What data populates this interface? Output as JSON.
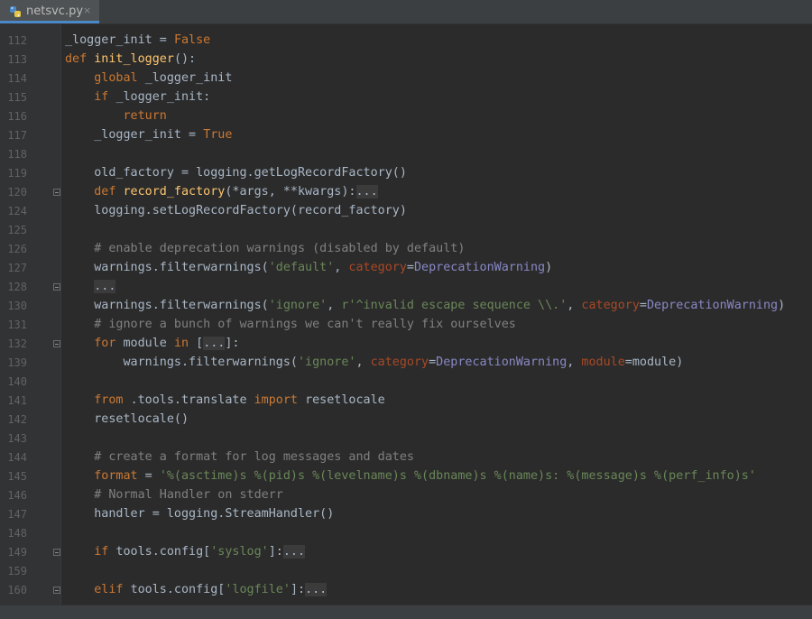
{
  "tab": {
    "filename": "netsvc.py",
    "close": "×"
  },
  "editor": {
    "lines": [
      {
        "number": "112",
        "fold": false,
        "tokens": [
          [
            "",
            "_logger_init = "
          ],
          [
            "kw",
            "False"
          ]
        ]
      },
      {
        "number": "113",
        "fold": false,
        "tokens": [
          [
            "kw",
            "def "
          ],
          [
            "fn",
            "init_logger"
          ],
          [
            "",
            "():"
          ]
        ]
      },
      {
        "number": "114",
        "fold": false,
        "tokens": [
          [
            "",
            "    "
          ],
          [
            "kw",
            "global "
          ],
          [
            "",
            "_logger_init"
          ]
        ]
      },
      {
        "number": "115",
        "fold": false,
        "tokens": [
          [
            "",
            "    "
          ],
          [
            "kw",
            "if "
          ],
          [
            "",
            "_logger_init:"
          ]
        ]
      },
      {
        "number": "116",
        "fold": false,
        "tokens": [
          [
            "",
            "        "
          ],
          [
            "kw",
            "return"
          ]
        ]
      },
      {
        "number": "117",
        "fold": false,
        "tokens": [
          [
            "",
            "    _logger_init = "
          ],
          [
            "kw",
            "True"
          ]
        ]
      },
      {
        "number": "118",
        "fold": false,
        "tokens": []
      },
      {
        "number": "119",
        "fold": false,
        "tokens": [
          [
            "",
            "    old_factory = logging.getLogRecordFactory()"
          ]
        ]
      },
      {
        "number": "120",
        "fold": true,
        "tokens": [
          [
            "",
            "    "
          ],
          [
            "kw",
            "def "
          ],
          [
            "fn",
            "record_factory"
          ],
          [
            "",
            "(*args, **kwargs):"
          ],
          [
            "ph",
            "..."
          ]
        ]
      },
      {
        "number": "124",
        "fold": false,
        "tokens": [
          [
            "",
            "    logging.setLogRecordFactory(record_factory)"
          ]
        ]
      },
      {
        "number": "125",
        "fold": false,
        "tokens": []
      },
      {
        "number": "126",
        "fold": false,
        "tokens": [
          [
            "",
            "    "
          ],
          [
            "cm",
            "# enable deprecation warnings (disabled by default)"
          ]
        ]
      },
      {
        "number": "127",
        "fold": false,
        "tokens": [
          [
            "",
            "    warnings.filterwarnings("
          ],
          [
            "st",
            "'default'"
          ],
          [
            "",
            ", "
          ],
          [
            "kp",
            "category"
          ],
          [
            "",
            "="
          ],
          [
            "cl",
            "DeprecationWarning"
          ],
          [
            "",
            ")"
          ]
        ]
      },
      {
        "number": "128",
        "fold": true,
        "tokens": [
          [
            "",
            "    "
          ],
          [
            "ph",
            "..."
          ]
        ]
      },
      {
        "number": "130",
        "fold": false,
        "tokens": [
          [
            "",
            "    warnings.filterwarnings("
          ],
          [
            "st",
            "'ignore'"
          ],
          [
            "",
            ", "
          ],
          [
            "st",
            "r'^invalid escape sequence \\\\.'"
          ],
          [
            "",
            ", "
          ],
          [
            "kp",
            "category"
          ],
          [
            "",
            "="
          ],
          [
            "cl",
            "DeprecationWarning"
          ],
          [
            "",
            ")"
          ]
        ]
      },
      {
        "number": "131",
        "fold": false,
        "tokens": [
          [
            "",
            "    "
          ],
          [
            "cm",
            "# ignore a bunch of warnings we can't really fix ourselves"
          ]
        ]
      },
      {
        "number": "132",
        "fold": true,
        "tokens": [
          [
            "",
            "    "
          ],
          [
            "kw",
            "for "
          ],
          [
            "",
            "module "
          ],
          [
            "kw",
            "in "
          ],
          [
            "",
            "["
          ],
          [
            "ph",
            "..."
          ],
          [
            "",
            "]:"
          ]
        ]
      },
      {
        "number": "139",
        "fold": false,
        "tokens": [
          [
            "",
            "        warnings.filterwarnings("
          ],
          [
            "st",
            "'ignore'"
          ],
          [
            "",
            ", "
          ],
          [
            "kp",
            "category"
          ],
          [
            "",
            "="
          ],
          [
            "cl",
            "DeprecationWarning"
          ],
          [
            "",
            ", "
          ],
          [
            "kp",
            "module"
          ],
          [
            "",
            "=module)"
          ]
        ]
      },
      {
        "number": "140",
        "fold": false,
        "tokens": []
      },
      {
        "number": "141",
        "fold": false,
        "tokens": [
          [
            "",
            "    "
          ],
          [
            "kw",
            "from "
          ],
          [
            "",
            ".tools.translate "
          ],
          [
            "kw",
            "import "
          ],
          [
            "",
            "resetlocale"
          ]
        ]
      },
      {
        "number": "142",
        "fold": false,
        "tokens": [
          [
            "",
            "    resetlocale()"
          ]
        ]
      },
      {
        "number": "143",
        "fold": false,
        "tokens": []
      },
      {
        "number": "144",
        "fold": false,
        "tokens": [
          [
            "",
            "    "
          ],
          [
            "cm",
            "# create a format for log messages and dates"
          ]
        ]
      },
      {
        "number": "145",
        "fold": false,
        "tokens": [
          [
            "",
            "    "
          ],
          [
            "kw",
            "format"
          ],
          [
            "",
            " = "
          ],
          [
            "st",
            "'%(asctime)s %(pid)s %(levelname)s %(dbname)s %(name)s: %(message)s %(perf_info)s'"
          ]
        ]
      },
      {
        "number": "146",
        "fold": false,
        "tokens": [
          [
            "",
            "    "
          ],
          [
            "cm",
            "# Normal Handler on stderr"
          ]
        ]
      },
      {
        "number": "147",
        "fold": false,
        "tokens": [
          [
            "",
            "    handler = logging.StreamHandler()"
          ]
        ]
      },
      {
        "number": "148",
        "fold": false,
        "tokens": []
      },
      {
        "number": "149",
        "fold": true,
        "tokens": [
          [
            "",
            "    "
          ],
          [
            "kw",
            "if "
          ],
          [
            "",
            "tools.config["
          ],
          [
            "st",
            "'syslog'"
          ],
          [
            "",
            "]:"
          ],
          [
            "ph",
            "..."
          ]
        ]
      },
      {
        "number": "159",
        "fold": false,
        "tokens": []
      },
      {
        "number": "160",
        "fold": true,
        "tokens": [
          [
            "",
            "    "
          ],
          [
            "kw",
            "elif "
          ],
          [
            "",
            "tools.config["
          ],
          [
            "st",
            "'logfile'"
          ],
          [
            "",
            "]:"
          ],
          [
            "ph",
            "..."
          ]
        ]
      }
    ]
  }
}
